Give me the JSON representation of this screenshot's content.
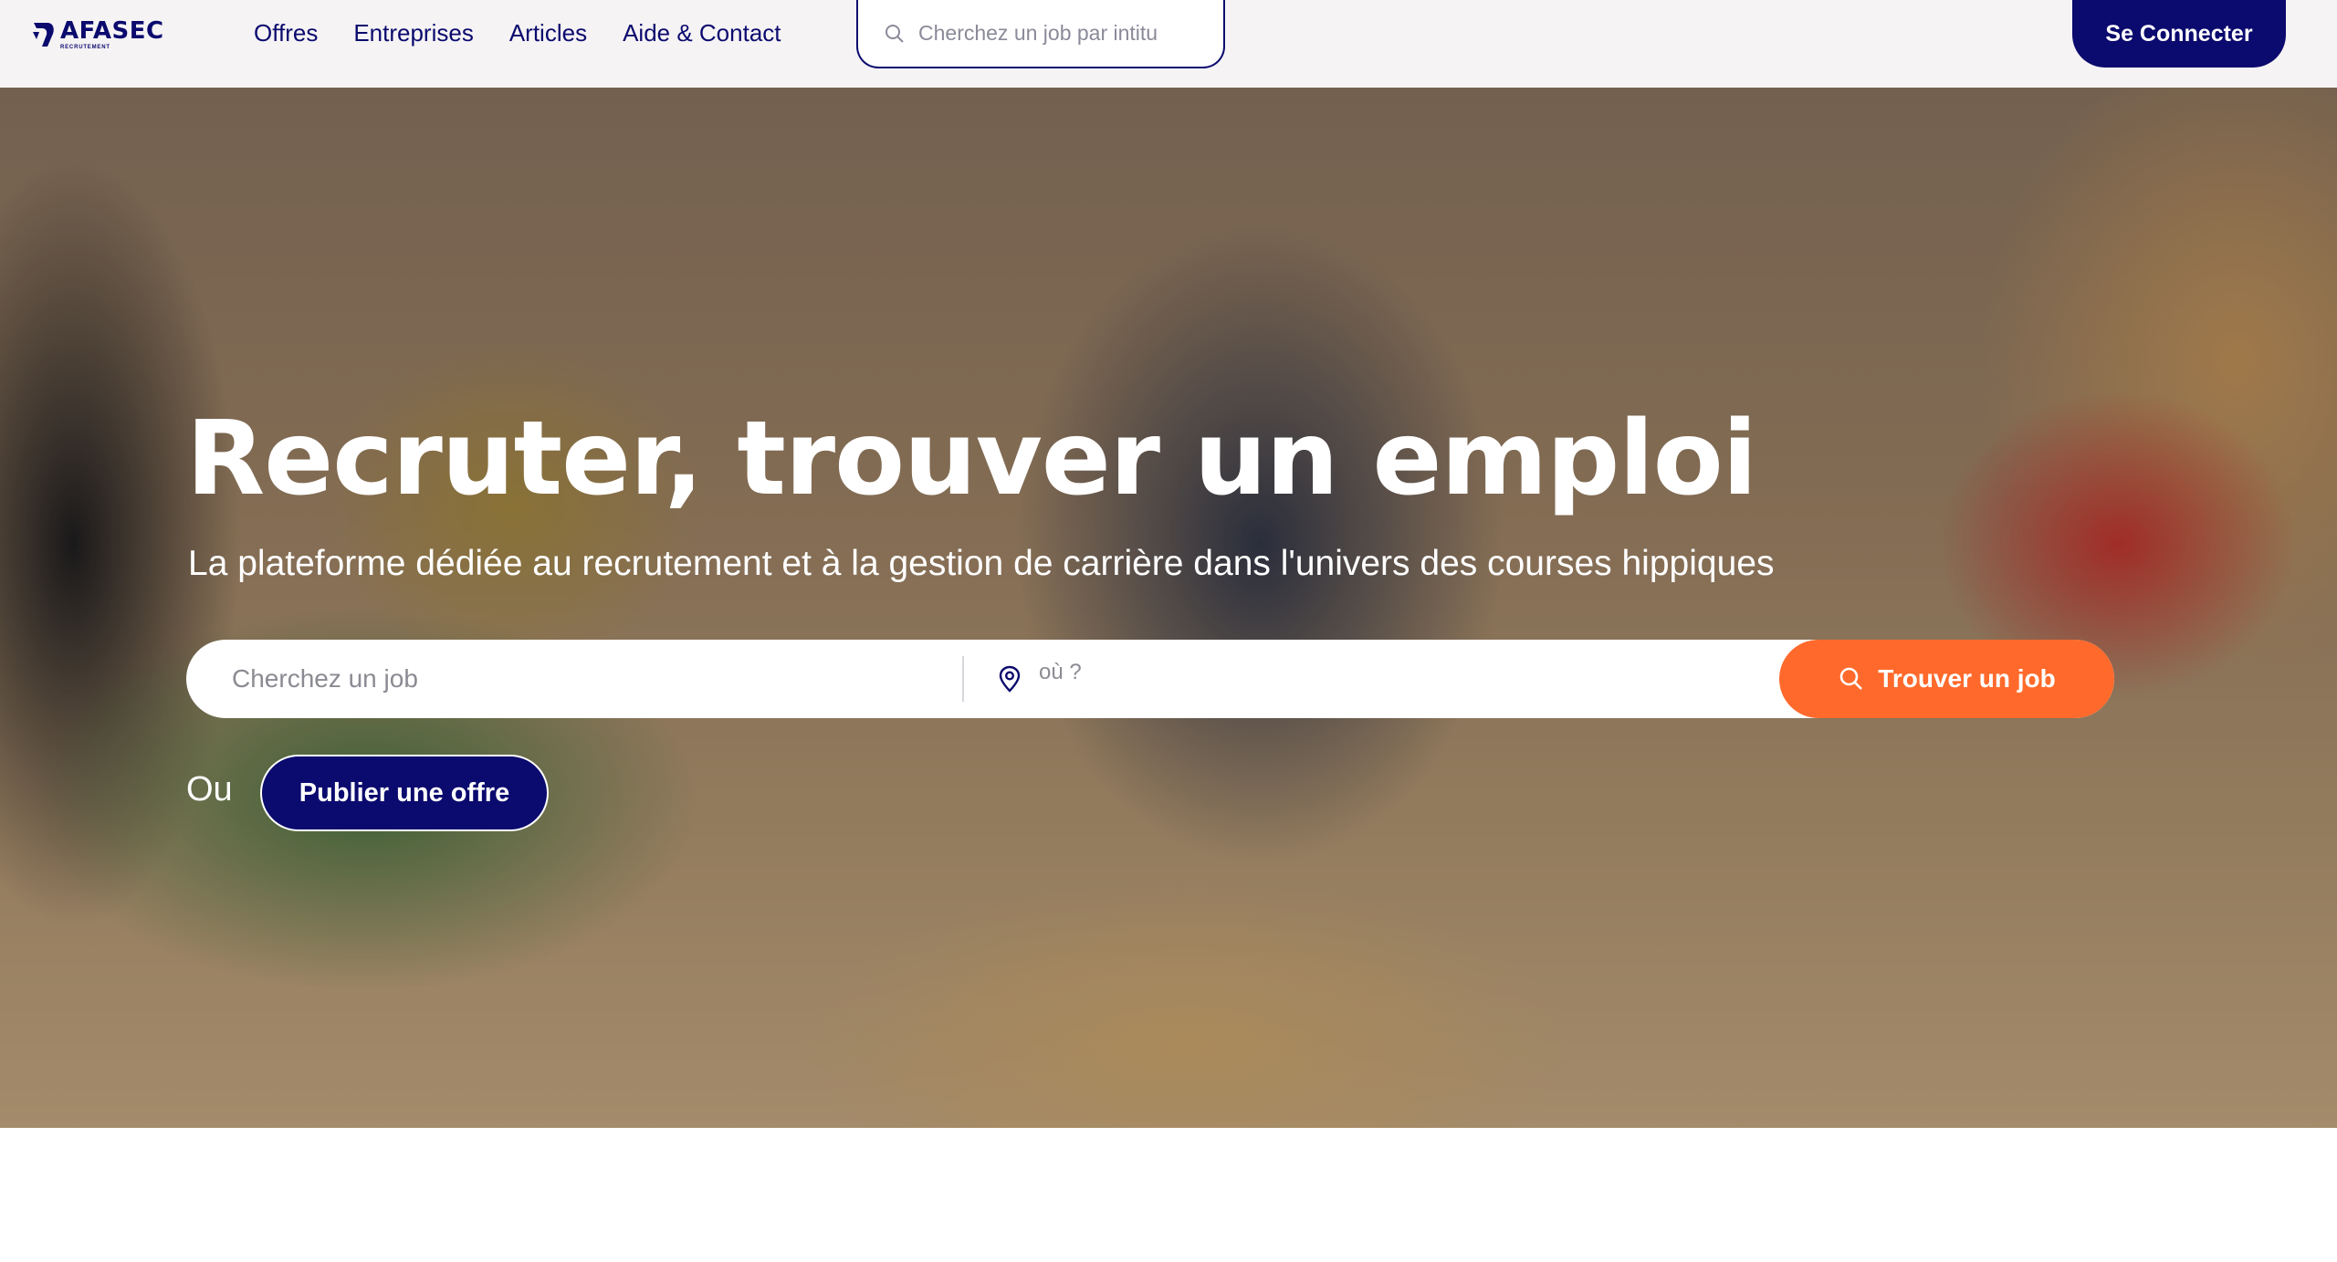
{
  "header": {
    "logo_name": "AFASEC",
    "logo_sub": "RECRUTEMENT",
    "nav": [
      "Offres",
      "Entreprises",
      "Articles",
      "Aide & Contact"
    ],
    "search_placeholder": "Cherchez un job par intitu",
    "login_label": "Se Connecter"
  },
  "hero": {
    "title": "Recruter, trouver un emploi",
    "subtitle": "La plateforme dédiée au recrutement et à la gestion de carrière dans l'univers des courses hippiques",
    "job_placeholder": "Cherchez un job",
    "location_placeholder": "où ?",
    "find_label": "Trouver un job",
    "or_label": "Ou",
    "publish_label": "Publier une offre"
  },
  "colors": {
    "brand_navy": "#0b0a6e",
    "accent_orange": "#ff6a2c",
    "header_bg": "#f5f3f4"
  },
  "icons": [
    "afasec-logo-icon",
    "search-icon",
    "location-pin-icon"
  ]
}
